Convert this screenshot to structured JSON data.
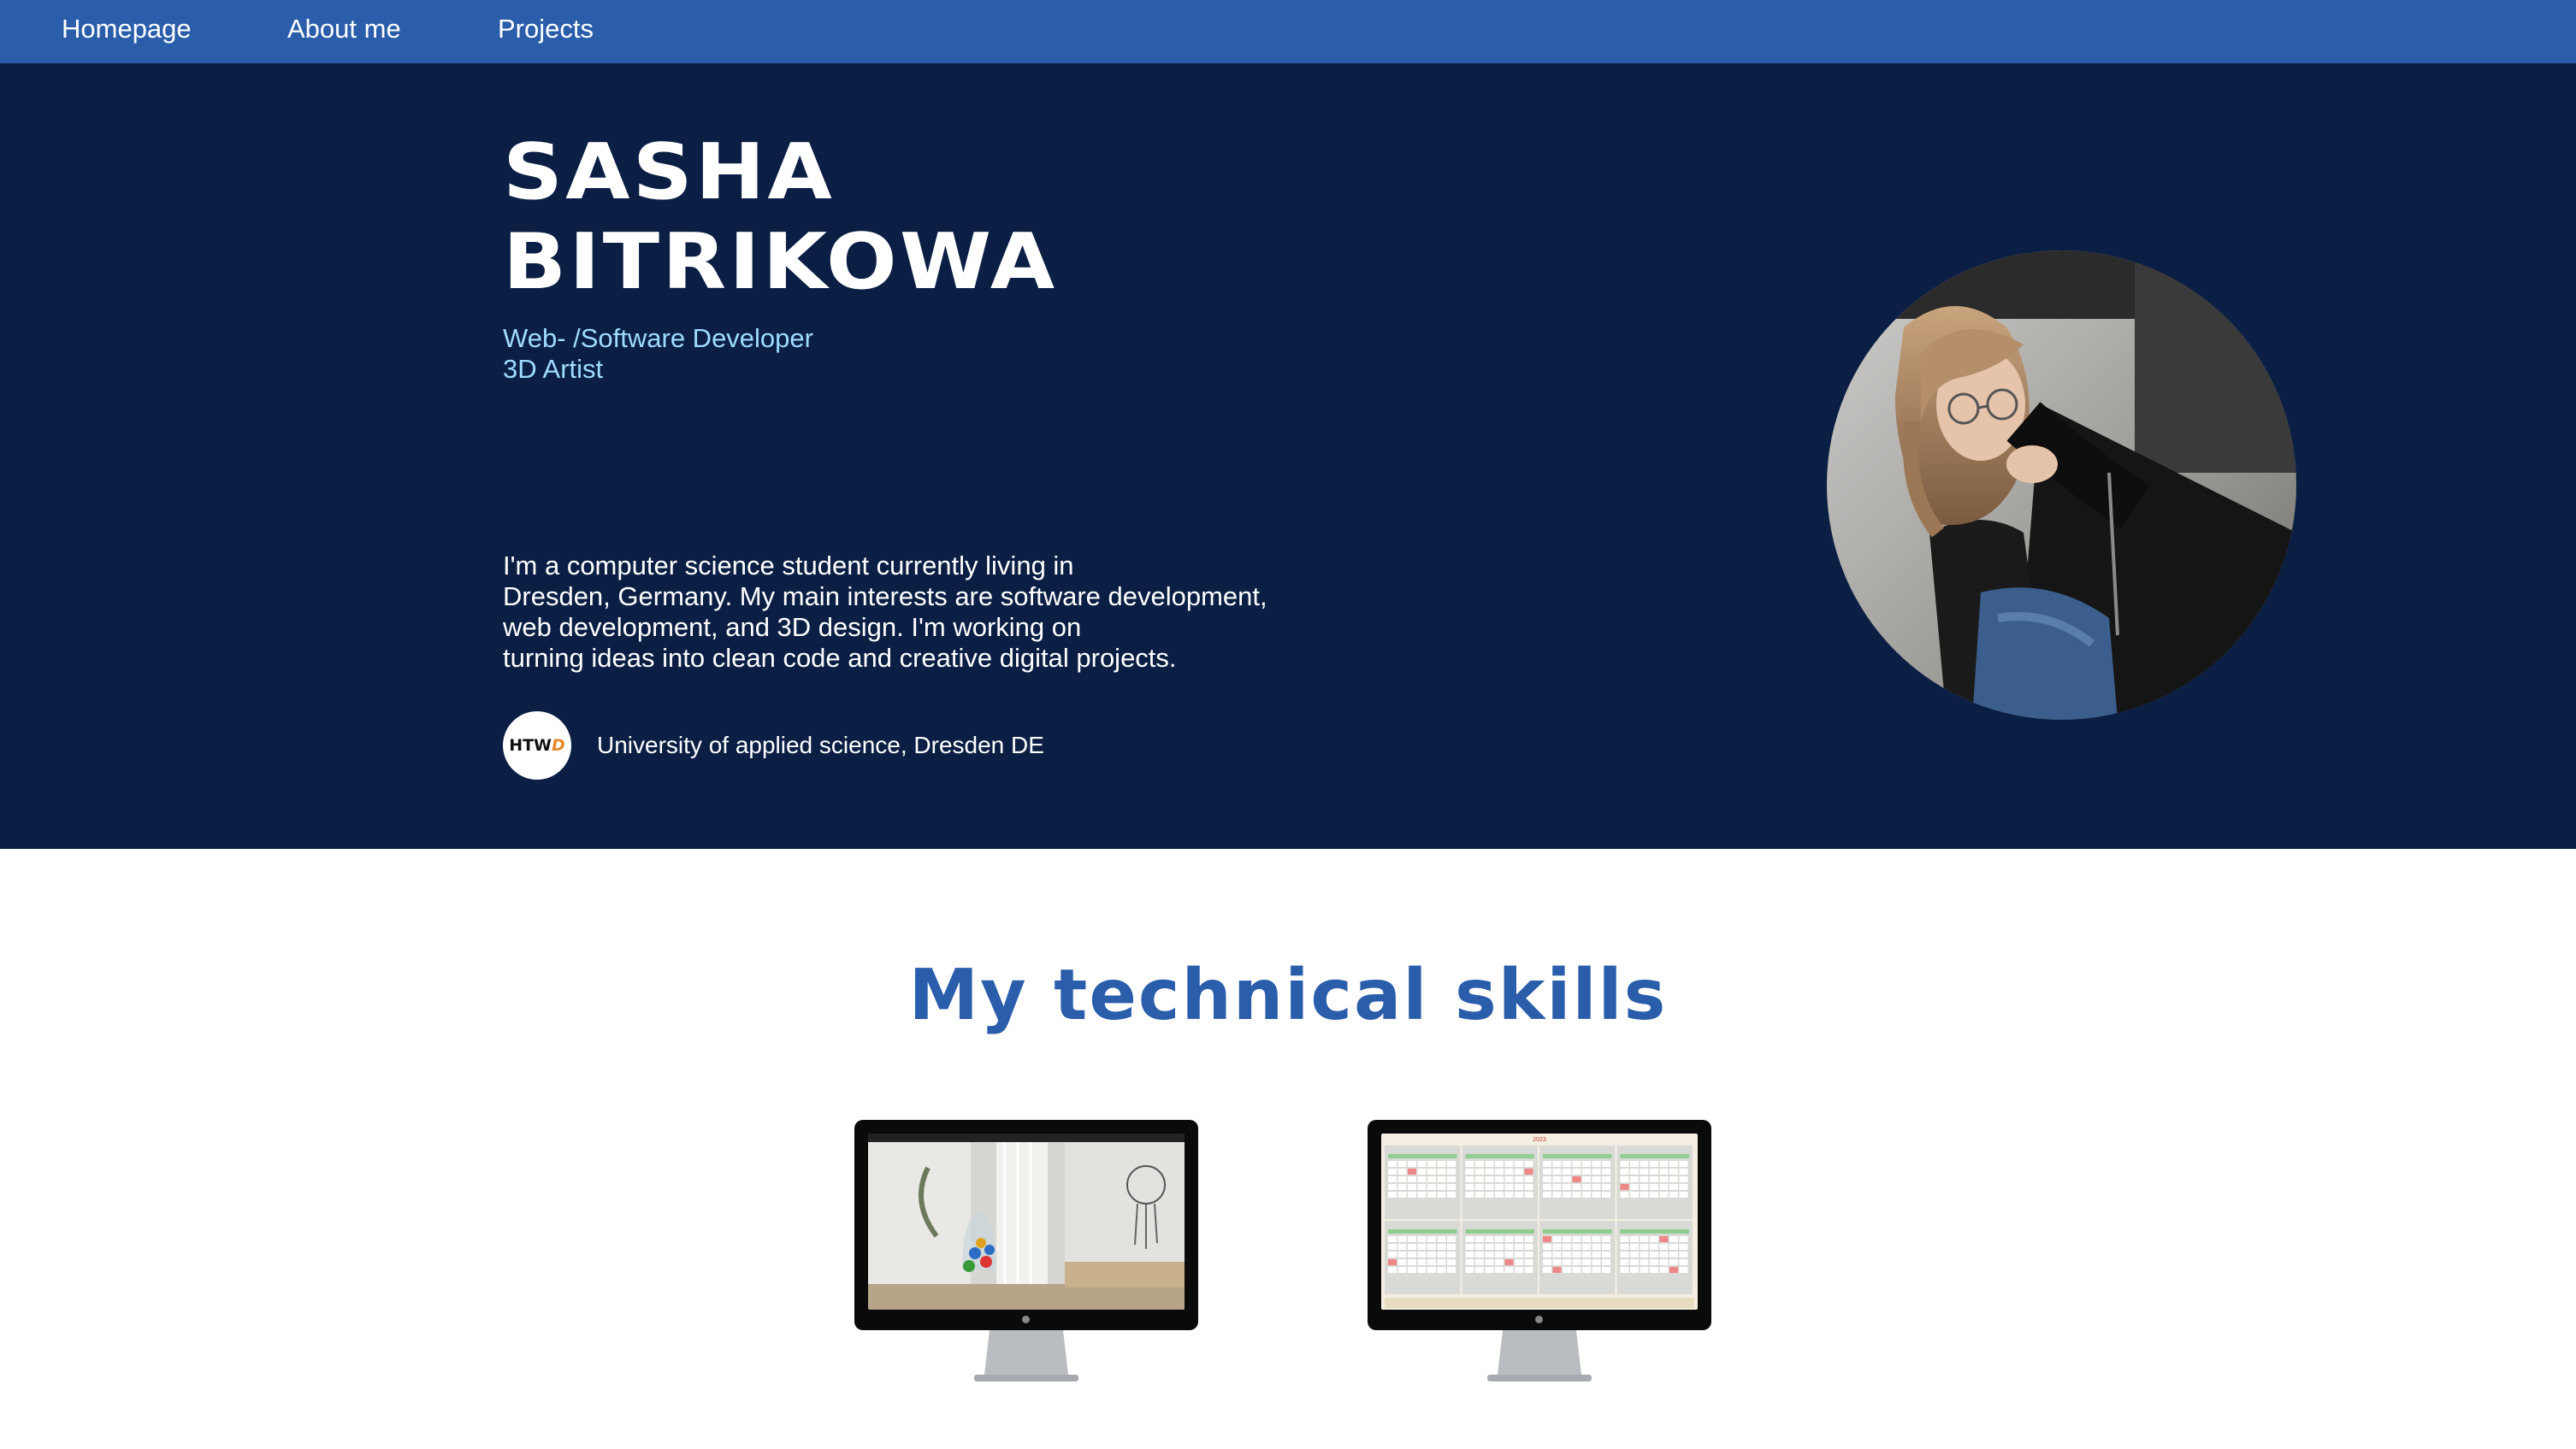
{
  "nav": {
    "items": [
      {
        "label": "Homepage"
      },
      {
        "label": "About me"
      },
      {
        "label": "Projects"
      }
    ]
  },
  "hero": {
    "name_line1": "SASHA",
    "name_line2": "BITRIKOWA",
    "subtitle_line1": "Web- /Software Developer",
    "subtitle_line2": "3D Artist",
    "bio_lines": [
      "I'm a computer science student currently living in",
      "Dresden, Germany. My main interests are software development,",
      "web development, and 3D design. I'm working on",
      "turning ideas into clean code and creative digital projects."
    ],
    "university": {
      "logo_text": "HTW",
      "logo_accent": "D",
      "name": "University of applied science, Dresden DE"
    }
  },
  "skills": {
    "title": "My technical skills",
    "calendar_year": "2023"
  },
  "colors": {
    "nav_bg": "#2a5daa",
    "hero_bg": "#0b1f44",
    "subtitle": "#9fdcff",
    "skills_title": "#2a5daa"
  }
}
